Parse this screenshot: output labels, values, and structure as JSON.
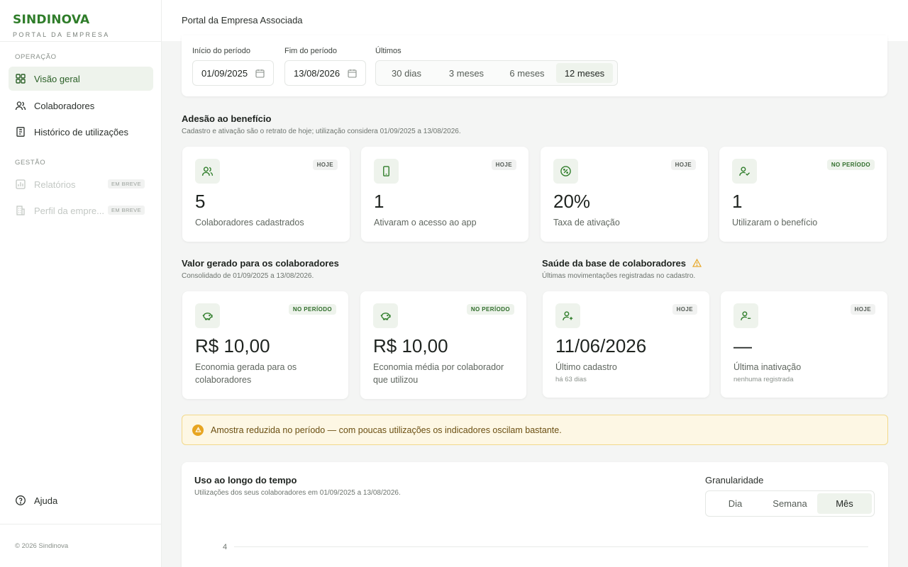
{
  "brand": {
    "name": "SINDINOVA",
    "subtitle": "PORTAL DA EMPRESA"
  },
  "sidebar": {
    "section_operacao": "OPERAÇÃO",
    "section_gestao": "GESTÃO",
    "items": [
      {
        "label": "Visão geral",
        "icon": "grid-icon",
        "active": true
      },
      {
        "label": "Colaboradores",
        "icon": "users-icon"
      },
      {
        "label": "Histórico de utilizações",
        "icon": "receipt-icon"
      },
      {
        "label": "Relatórios",
        "icon": "chart-icon",
        "badge": "EM BREVE",
        "disabled": true
      },
      {
        "label": "Perfil da empre...",
        "icon": "building-icon",
        "badge": "EM BREVE",
        "disabled": true
      }
    ],
    "help": "Ajuda",
    "copyright": "© 2026 Sindinova"
  },
  "header": {
    "title": "Portal da Empresa Associada"
  },
  "filters": {
    "start_label": "Início do período",
    "start_value": "01/09/2025",
    "end_label": "Fim do período",
    "end_value": "13/08/2026",
    "last_label": "Últimos",
    "ranges": [
      "30 dias",
      "3 meses",
      "6 meses",
      "12 meses"
    ],
    "active_range": "12 meses"
  },
  "adesao": {
    "title": "Adesão ao benefício",
    "subtitle": "Cadastro e ativação são o retrato de hoje; utilização considera 01/09/2025 a 13/08/2026.",
    "cards": [
      {
        "value": "5",
        "label": "Colaboradores cadastrados",
        "badge": "HOJE",
        "icon": "users-icon"
      },
      {
        "value": "1",
        "label": "Ativaram o acesso ao app",
        "badge": "HOJE",
        "icon": "smartphone-icon"
      },
      {
        "value": "20%",
        "label": "Taxa de ativação",
        "badge": "HOJE",
        "icon": "percent-icon"
      },
      {
        "value": "1",
        "label": "Utilizaram o benefício",
        "badge": "NO PERÍODO",
        "icon": "user-check-icon"
      }
    ]
  },
  "valor": {
    "title": "Valor gerado para os colaboradores",
    "subtitle": "Consolidado de 01/09/2025 a 13/08/2026.",
    "cards": [
      {
        "value": "R$ 10,00",
        "label": "Economia gerada para os colaboradores",
        "badge": "NO PERÍODO",
        "icon": "piggy-bank-icon"
      },
      {
        "value": "R$ 10,00",
        "label": "Economia média por colaborador que utilizou",
        "badge": "NO PERÍODO",
        "icon": "piggy-bank-icon"
      }
    ]
  },
  "saude": {
    "title": "Saúde da base de colaboradores",
    "subtitle": "Últimas movimentações registradas no cadastro.",
    "cards": [
      {
        "value": "11/06/2026",
        "label": "Último cadastro",
        "sub": "há 63 dias",
        "badge": "HOJE",
        "icon": "user-plus-icon"
      },
      {
        "value": "—",
        "label": "Última inativação",
        "sub": "nenhuma registrada",
        "badge": "HOJE",
        "icon": "user-minus-icon"
      }
    ]
  },
  "alert": {
    "text": "Amostra reduzida no período — com poucas utilizações os indicadores oscilam bastante."
  },
  "chart": {
    "title": "Uso ao longo do tempo",
    "subtitle": "Utilizações dos seus colaboradores em 01/09/2025 a 13/08/2026.",
    "granularity_label": "Granularidade",
    "granularity_options": [
      "Dia",
      "Semana",
      "Mês"
    ],
    "active_granularity": "Mês",
    "y_tick": "4"
  },
  "colors": {
    "brand": "#2f7d2a",
    "accent_bg": "#eef3ec",
    "warning": "#e7a521"
  }
}
